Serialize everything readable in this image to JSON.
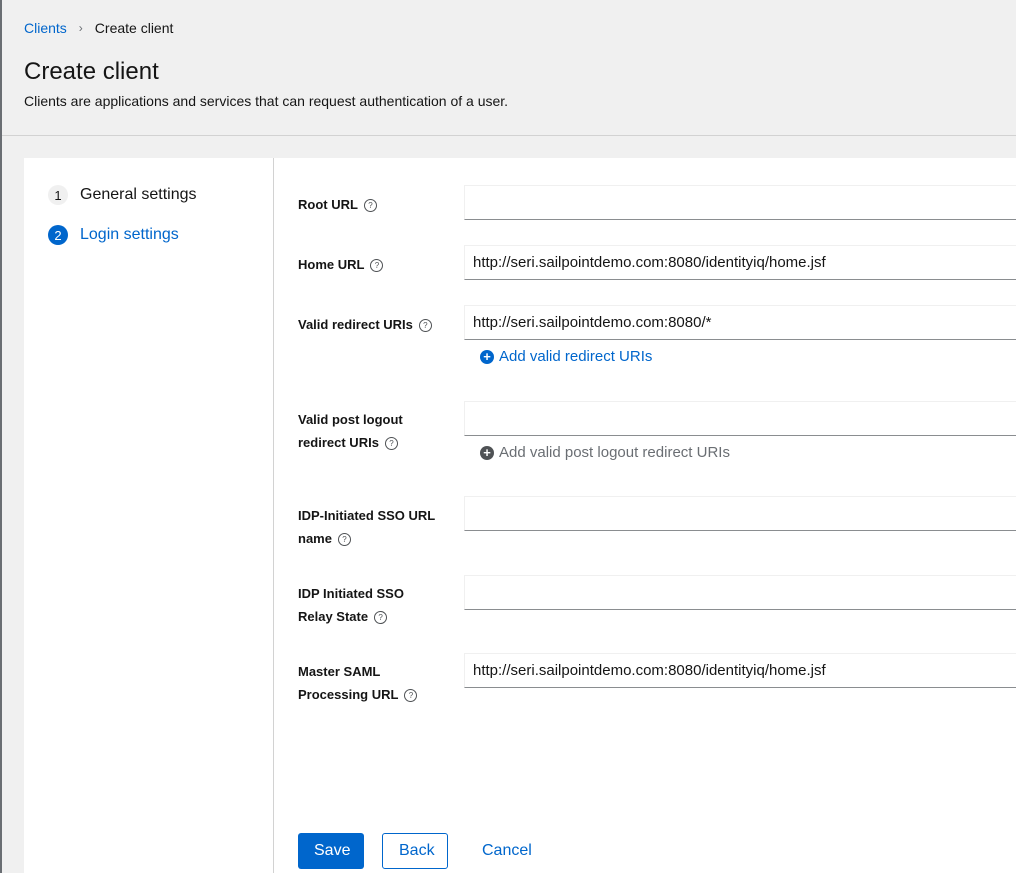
{
  "breadcrumb": {
    "parent": "Clients",
    "separator": "›",
    "current": "Create client"
  },
  "header": {
    "title": "Create client",
    "description": "Clients are applications and services that can request authentication of a user."
  },
  "wizard": {
    "steps": [
      {
        "number": "1",
        "label": "General settings",
        "state": "done"
      },
      {
        "number": "2",
        "label": "Login settings",
        "state": "current"
      }
    ]
  },
  "form": {
    "help_glyph": "?",
    "root_url": {
      "label": "Root URL",
      "value": ""
    },
    "home_url": {
      "label": "Home URL",
      "value": "http://seri.sailpointdemo.com:8080/identityiq/home.jsf"
    },
    "valid_redirect_uris": {
      "label": "Valid redirect URIs",
      "value": "http://seri.sailpointdemo.com:8080/*",
      "add_label": "Add valid redirect URIs"
    },
    "valid_post_logout_redirect_uris": {
      "label_line1": "Valid post logout",
      "label_line2": "redirect URIs",
      "value": "",
      "add_label": "Add valid post logout redirect URIs"
    },
    "idp_sso_url_name": {
      "label_line1": "IDP-Initiated SSO URL",
      "label_line2": "name",
      "value": ""
    },
    "idp_relay_state": {
      "label_line1": "IDP Initiated SSO",
      "label_line2": "Relay State",
      "value": ""
    },
    "master_saml_url": {
      "label_line1": "Master SAML",
      "label_line2": "Processing URL",
      "value": "http://seri.sailpointdemo.com:8080/identityiq/home.jsf"
    }
  },
  "actions": {
    "save": "Save",
    "back": "Back",
    "cancel": "Cancel"
  },
  "colors": {
    "accent": "#0066cc",
    "page_bg": "#f0f0f0",
    "panel_bg": "#ffffff"
  },
  "icons": {
    "add": "plus-circle-icon",
    "help": "question-circle-icon",
    "breadcrumb_sep": "angle-right-icon"
  }
}
